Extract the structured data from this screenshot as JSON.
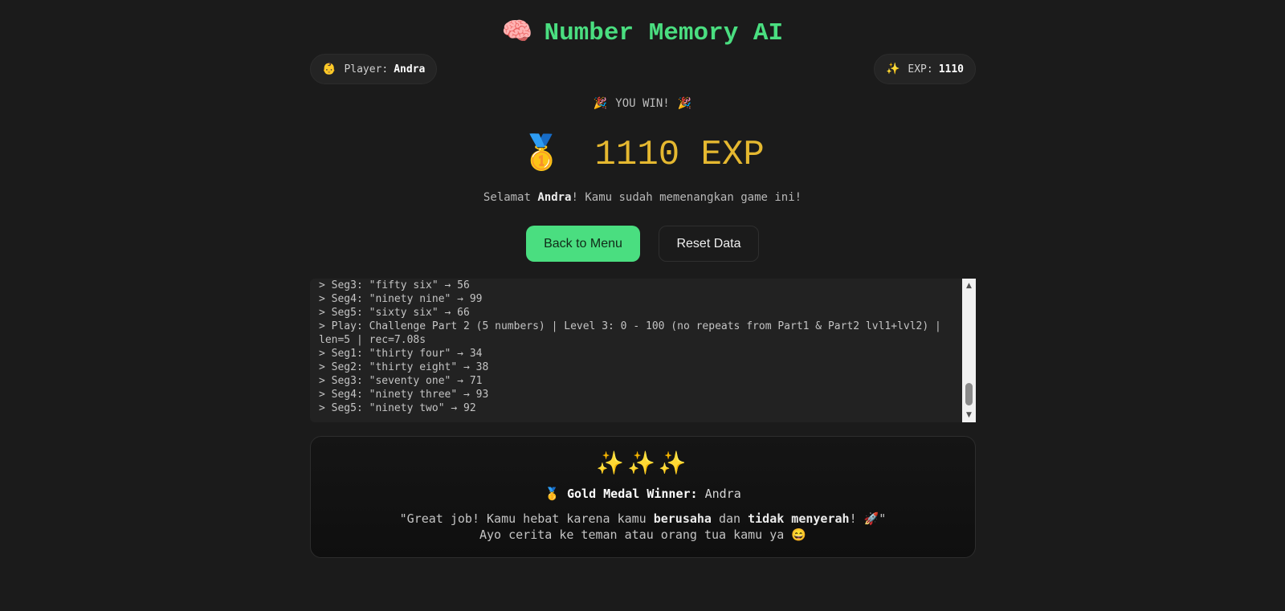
{
  "header": {
    "title_emoji": "🧠",
    "title": "Number Memory AI"
  },
  "player_pill": {
    "icon": "👶",
    "label": "Player:",
    "value": "Andra"
  },
  "exp_pill": {
    "icon": "✨",
    "label": "EXP:",
    "value": "1110"
  },
  "result": {
    "party_emoji": "🎉",
    "you_win": "YOU WIN!",
    "medal_emoji": "🥇",
    "exp_text": "1110 EXP",
    "congrats_prefix": "Selamat ",
    "congrats_name": "Andra",
    "congrats_suffix": "! Kamu sudah memenangkan game ini!"
  },
  "buttons": {
    "back_to_menu": "Back to Menu",
    "reset_data": "Reset Data"
  },
  "log": {
    "lines": [
      "> Seg3: \"fifty six\" → 56",
      "> Seg4: \"ninety nine\" → 99",
      "> Seg5: \"sixty six\" → 66",
      "> Play: Challenge Part 2 (5 numbers) | Level 3: 0 - 100 (no repeats from Part1 & Part2 lvl1+lvl2) | len=5 | rec=7.08s",
      "> Seg1: \"thirty four\" → 34",
      "> Seg2: \"thirty eight\" → 38",
      "> Seg3: \"seventy one\" → 71",
      "> Seg4: \"ninety three\" → 93",
      "> Seg5: \"ninety two\" → 92"
    ],
    "scroll_up": "▲",
    "scroll_down": "▼"
  },
  "card": {
    "sparkles": "✨✨✨",
    "winner_medal": "🥇",
    "winner_label": "Gold Medal Winner:",
    "winner_name": "Andra",
    "quote_1": "\"Great job! Kamu hebat karena kamu ",
    "quote_bold_1": "berusaha",
    "quote_2": " dan ",
    "quote_bold_2": "tidak menyerah",
    "quote_3": "! 🚀\"",
    "line2": "Ayo cerita ke teman atau orang tua kamu ya 😄"
  }
}
